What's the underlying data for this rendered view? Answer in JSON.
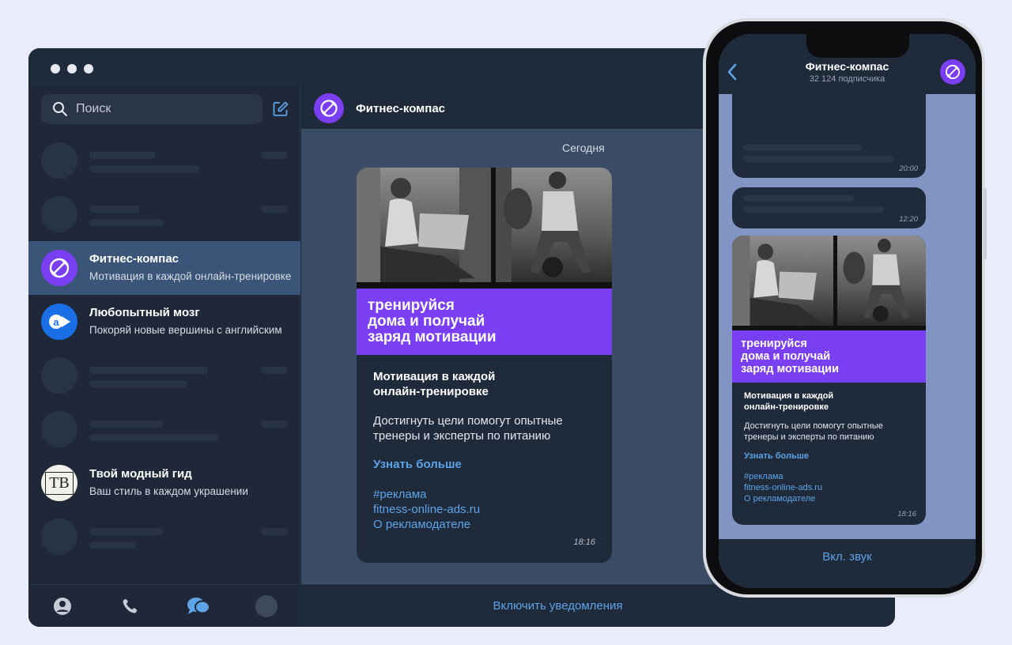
{
  "search": {
    "placeholder": "Поиск"
  },
  "chats": [
    {
      "name": "Фитнес-компас",
      "preview": "Мотивация в каждой онлайн-тренировке"
    },
    {
      "name": "Любопытный мозг",
      "preview": "Покоряй новые вершины с английским"
    },
    {
      "name": "Твой модный гид",
      "preview": "Ваш стиль в каждом украшении",
      "avatar_text": "TB"
    }
  ],
  "channel": {
    "title": "Фитнес-компас"
  },
  "day_label": "Сегодня",
  "post": {
    "banner": "тренируйся\nдома и получай\nзаряд мотивации",
    "title": "Мотивация в каждой\nонлайн-тренировке",
    "description": "Достигнуть цели помогут опытные\nтренеры и эксперты по питанию",
    "link": "Узнать больше",
    "hashtag": "#реклама",
    "site": "fitness-online-ads.ru",
    "about": "О рекламодателе",
    "time": "18:16"
  },
  "notify_button": "Включить уведомления",
  "phone": {
    "title": "Фитнес-компас",
    "subtitle": "32 124 подписчика",
    "bubble_times": [
      "20:00",
      "12:20"
    ],
    "post_time": "18:16",
    "sound_button": "Вкл. звук"
  },
  "colors": {
    "accent": "#7a3ff2",
    "link": "#5ea4e8",
    "panel": "#1f2a3b"
  },
  "icons": [
    "search-icon",
    "compose-icon",
    "dumbbell-icon",
    "contacts-icon",
    "phone-icon",
    "chats-icon",
    "back-icon"
  ]
}
